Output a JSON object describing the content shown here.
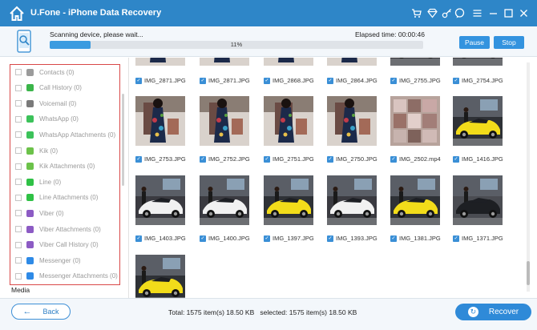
{
  "app": {
    "title": "U.Fone - iPhone Data Recovery"
  },
  "scan": {
    "status": "Scanning device, please wait...",
    "elapsed": "Elapsed time: 00:00:46",
    "progress_label": "11%",
    "progress_fraction": 0.11,
    "pause_label": "Pause",
    "stop_label": "Stop"
  },
  "categories": [
    {
      "label": "Contacts (0)",
      "icon": "contacts-icon",
      "color": "#9b9b9b"
    },
    {
      "label": "Call History (0)",
      "icon": "phone-icon",
      "color": "#3bb54a"
    },
    {
      "label": "Voicemail (0)",
      "icon": "voicemail-icon",
      "color": "#7a7a7a"
    },
    {
      "label": "WhatsApp (0)",
      "icon": "whatsapp-icon",
      "color": "#3cc25a"
    },
    {
      "label": "WhatsApp Attachments (0)",
      "icon": "whatsapp-icon",
      "color": "#3cc25a"
    },
    {
      "label": "Kik (0)",
      "icon": "kik-icon",
      "color": "#6cc24a"
    },
    {
      "label": "Kik Attachments (0)",
      "icon": "kik-icon",
      "color": "#6cc24a"
    },
    {
      "label": "Line (0)",
      "icon": "line-icon",
      "color": "#2fc146"
    },
    {
      "label": "Line Attachments (0)",
      "icon": "line-icon",
      "color": "#2fc146"
    },
    {
      "label": "Viber (0)",
      "icon": "viber-icon",
      "color": "#8c5bc4"
    },
    {
      "label": "Viber Attachments (0)",
      "icon": "viber-icon",
      "color": "#8c5bc4"
    },
    {
      "label": "Viber Call History (0)",
      "icon": "viber-icon",
      "color": "#8c5bc4"
    },
    {
      "label": "Messenger (0)",
      "icon": "messenger-icon",
      "color": "#2e8ae6"
    },
    {
      "label": "Messenger Attachments (0)",
      "icon": "messenger-icon",
      "color": "#2e8ae6"
    }
  ],
  "sidebar": {
    "media_label": "Media"
  },
  "top_labels": [
    "IMG_2871.JPG",
    "IMG_2871.JPG",
    "IMG_2868.JPG",
    "IMG_2864.JPG",
    "IMG_2755.JPG",
    "IMG_2754.JPG"
  ],
  "rows": [
    [
      {
        "name": "IMG_2753.JPG",
        "kind": "dress"
      },
      {
        "name": "IMG_2752.JPG",
        "kind": "dress"
      },
      {
        "name": "IMG_2751.JPG",
        "kind": "dress"
      },
      {
        "name": "IMG_2750.JPG",
        "kind": "dress"
      },
      {
        "name": "IMG_2502.mp4",
        "kind": "blur"
      },
      {
        "name": "IMG_1416.JPG",
        "kind": "yellow-car"
      }
    ],
    [
      {
        "name": "IMG_1403.JPG",
        "kind": "white-car"
      },
      {
        "name": "IMG_1400.JPG",
        "kind": "white-car"
      },
      {
        "name": "IMG_1397.JPG",
        "kind": "yellow-car"
      },
      {
        "name": "IMG_1393.JPG",
        "kind": "white-car"
      },
      {
        "name": "IMG_1381.JPG",
        "kind": "yellow-car"
      },
      {
        "name": "IMG_1371.JPG",
        "kind": "black-car"
      }
    ],
    [
      {
        "name": "",
        "kind": "yellow-car"
      }
    ]
  ],
  "footer": {
    "back_label": "Back",
    "total": "Total: 1575 item(s) 18.50 KB",
    "selected": "selected: 1575 item(s) 18.50 KB",
    "recover_label": "Recover"
  },
  "colors": {
    "titlebar": "#2e86c8",
    "accent": "#3393df",
    "highlight_border": "#d94848"
  }
}
